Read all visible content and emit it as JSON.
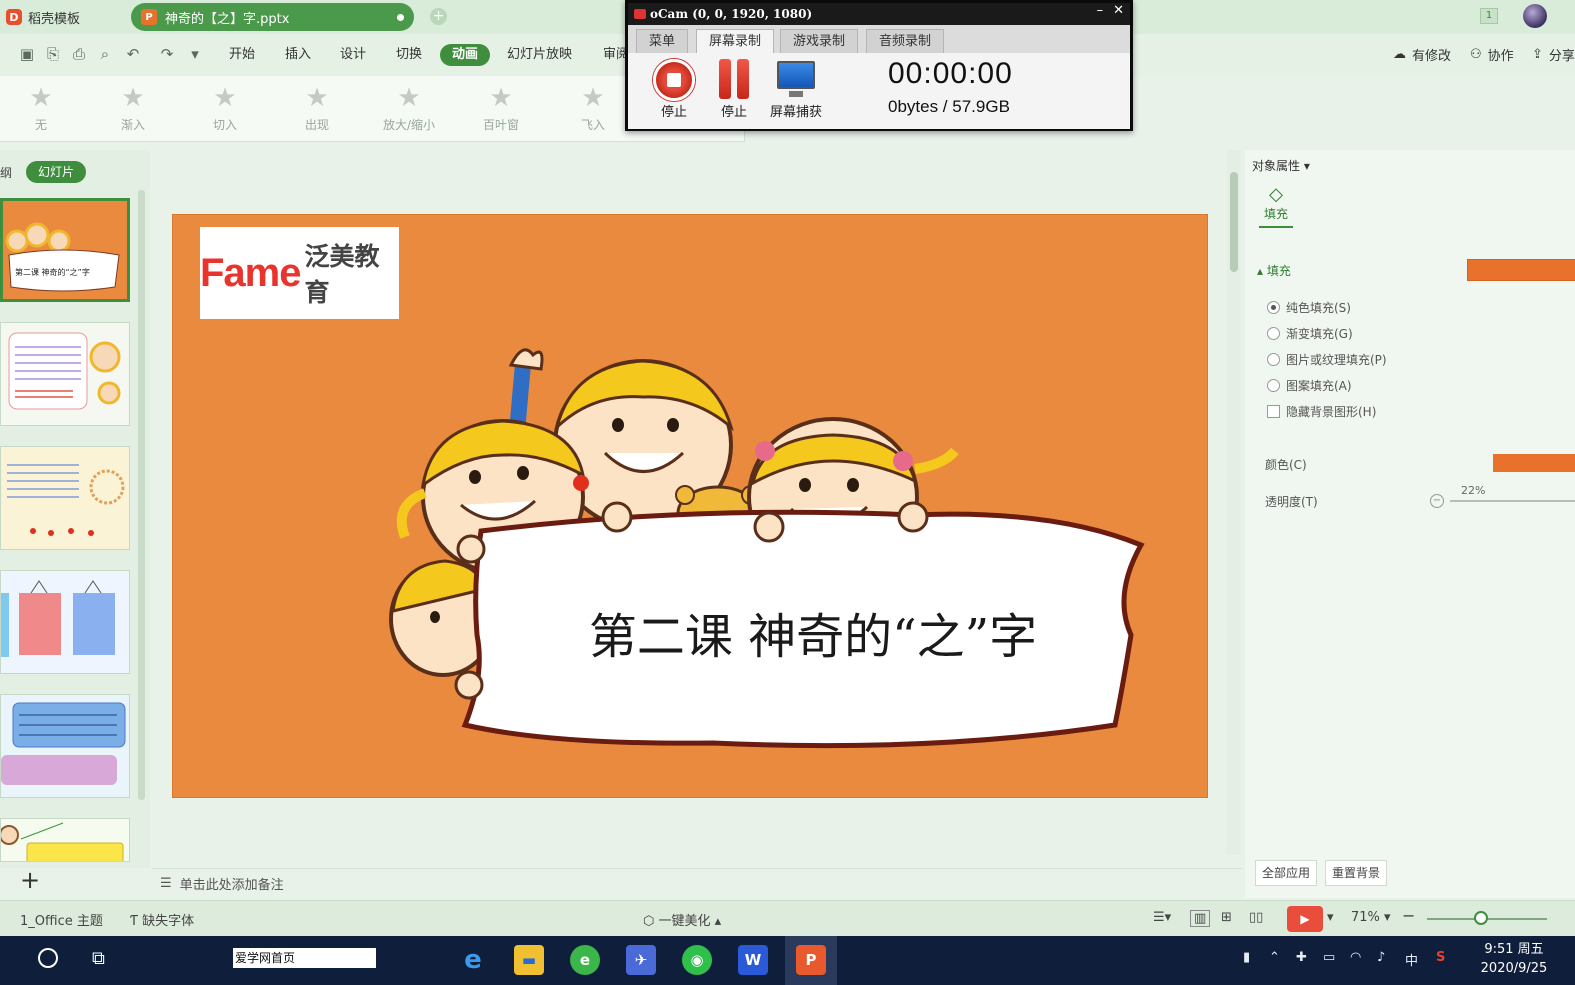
{
  "titlebar": {
    "app_name": "稻壳模板",
    "document_tab": "神奇的【之】字.pptx",
    "new_tab": "+",
    "window_badge": "1"
  },
  "menubar": {
    "items": [
      "开始",
      "插入",
      "设计",
      "切换",
      "动画",
      "幻灯片放映",
      "审阅"
    ],
    "active": "动画",
    "right_tools": [
      "有修改",
      "协作",
      "分享"
    ]
  },
  "animation_ribbon": {
    "effects": [
      "无",
      "渐入",
      "切入",
      "出现",
      "放大/缩小",
      "百叶窗",
      "飞入"
    ]
  },
  "left_panel": {
    "tab_outline": "纲",
    "tab_slides": "幻灯片",
    "thumbnail1_text": "第二课 神奇的“之”字",
    "add_slide": "+"
  },
  "slide": {
    "logo_text": "Fame",
    "logo_cn": "泛美教育",
    "title": "第二课  神奇的“之”字"
  },
  "notes": {
    "placeholder": "单击此处添加备注"
  },
  "right_panel": {
    "title": "对象属性",
    "fill_tab": "填充",
    "section": "填充",
    "options": [
      "纯色填充(S)",
      "渐变填充(G)",
      "图片或纹理填充(P)",
      "图案填充(A)"
    ],
    "hide_bg": "隐藏背景图形(H)",
    "color_label": "颜色(C)",
    "transparency_label": "透明度(T)",
    "transparency_value": "22%",
    "apply_all": "全部应用",
    "reset_bg": "重置背景",
    "fill_color": "#e8722c"
  },
  "statusbar": {
    "theme": "1_Office 主题",
    "missing_font": "缺失字体",
    "beautify": "一键美化",
    "zoom": "71%",
    "zoom_level": 0.45
  },
  "taskbar": {
    "search_text": "爱学网首页",
    "clock_time": "9:51 周五",
    "clock_date": "2020/9/25",
    "ime": "中"
  },
  "ocam": {
    "title": "oCam (0, 0, 1920, 1080)",
    "tabs": [
      "菜单",
      "屏幕录制",
      "游戏录制",
      "音频录制"
    ],
    "active_tab": "屏幕录制",
    "stop_label": "停止",
    "pause_label": "停止",
    "capture_label": "屏幕捕获",
    "timer": "00:00:00",
    "size": "0bytes / 57.9GB"
  }
}
